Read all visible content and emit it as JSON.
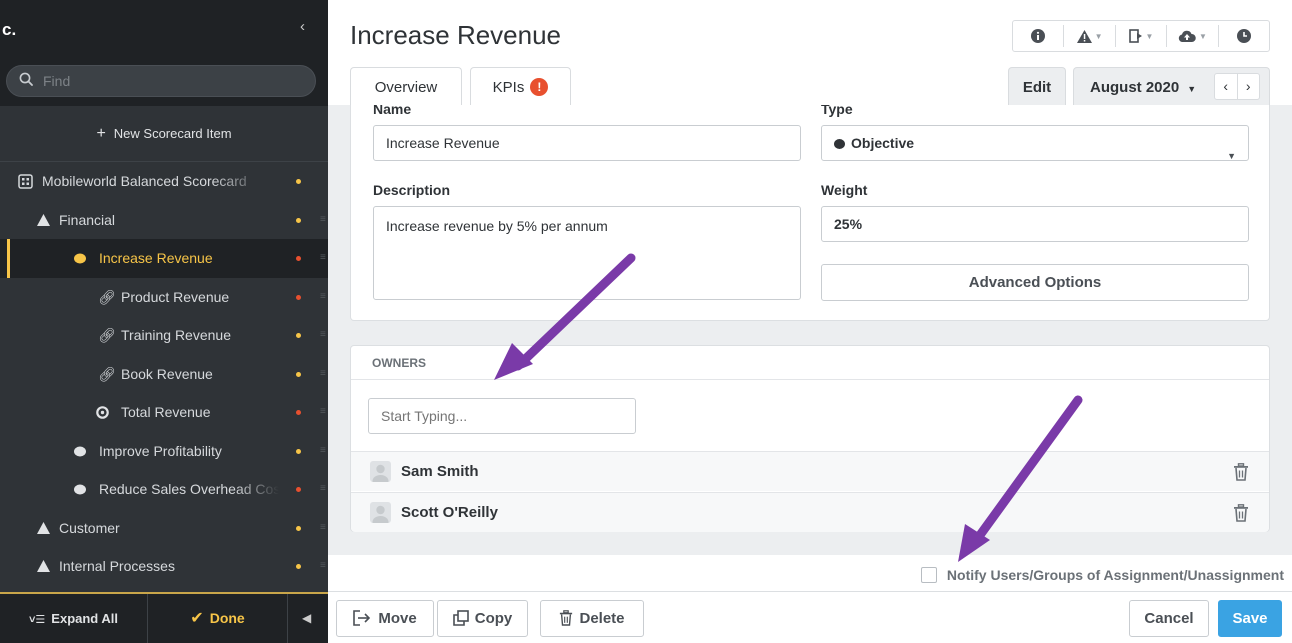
{
  "sidebar": {
    "company": "c.",
    "collapse_glyph": "‹",
    "search_placeholder": "Find",
    "new_item": "New Scorecard Item",
    "tree": [
      {
        "label": "Mobileworld Balanced Scorecard",
        "icon": "scorecard-icon",
        "dot": "#f7c548"
      },
      {
        "label": "Financial",
        "icon": "triangle-icon",
        "dot": "#f7c548"
      },
      {
        "label": "Increase Revenue",
        "icon": "objective-dot-icon",
        "dot": "#e8502f",
        "active": true
      },
      {
        "label": "Product Revenue",
        "icon": "link-icon",
        "dot": "#e8502f"
      },
      {
        "label": "Training Revenue",
        "icon": "link-icon",
        "dot": "#f7c548"
      },
      {
        "label": "Book Revenue",
        "icon": "link-icon",
        "dot": "#f7c548"
      },
      {
        "label": "Total Revenue",
        "icon": "kpi-target-icon",
        "dot": "#e8502f"
      },
      {
        "label": "Improve Profitability",
        "icon": "objective-dot-icon",
        "dot": "#f7c548"
      },
      {
        "label": "Reduce Sales Overhead Costs",
        "icon": "objective-dot-icon",
        "dot": "#e8502f"
      },
      {
        "label": "Customer",
        "icon": "triangle-icon",
        "dot": "#f7c548"
      },
      {
        "label": "Internal Processes",
        "icon": "triangle-icon",
        "dot": "#f7c548"
      }
    ],
    "expand_all": "Expand All",
    "done": "Done"
  },
  "header": {
    "title": "Increase Revenue",
    "tabs": {
      "overview": "Overview",
      "kpis": "KPIs",
      "kpi_badge": "!"
    },
    "edit": "Edit",
    "period": "August 2020",
    "prev": "‹",
    "next": "›"
  },
  "form": {
    "name_label": "Name",
    "name_value": "Increase Revenue",
    "type_label": "Type",
    "type_value": "Objective",
    "description_label": "Description",
    "description_value": "Increase revenue by 5% per annum",
    "weight_label": "Weight",
    "weight_value": "25%",
    "advanced": "Advanced Options"
  },
  "owners": {
    "header": "OWNERS",
    "placeholder": "Start Typing...",
    "list": [
      "Sam Smith",
      "Scott O'Reilly"
    ]
  },
  "notify_label": "Notify Users/Groups of Assignment/Unassignment",
  "footer": {
    "move": "Move",
    "copy": "Copy",
    "delete": "Delete",
    "cancel": "Cancel",
    "save": "Save"
  },
  "colors": {
    "accent": "#f7c548",
    "alert": "#e8502f",
    "save": "#3aa3e3",
    "annotation_arrow": "#7a3aa8"
  }
}
